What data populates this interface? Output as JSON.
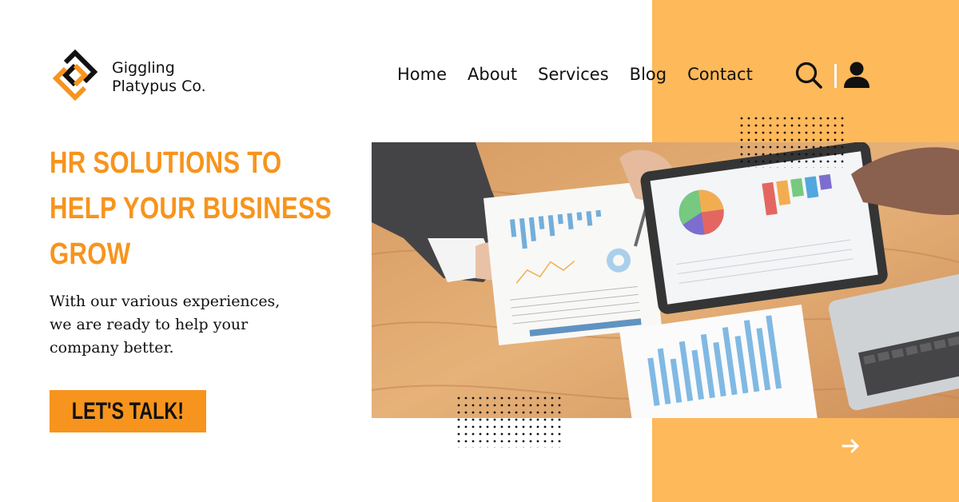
{
  "brand": {
    "name_line1": "Giggling",
    "name_line2": "Platypus Co.",
    "logo_icon": "diamond-arrows-logo"
  },
  "nav": {
    "items": [
      {
        "label": "Home"
      },
      {
        "label": "About"
      },
      {
        "label": "Services"
      },
      {
        "label": "Blog"
      },
      {
        "label": "Contact"
      }
    ],
    "icons": [
      "search-icon",
      "user-icon"
    ]
  },
  "hero": {
    "headline_lines": [
      "HR SOLUTIONS TO",
      "HELP YOUR BUSINESS",
      "GROW"
    ],
    "body_lines": [
      "With our various experiences,",
      "we are ready to help your",
      "company better."
    ],
    "cta_label": "LET'S TALK!",
    "image_icon": "business-charts-photo",
    "next_icon": "arrow-right-icon"
  },
  "colors": {
    "accent": "#f7941d",
    "panel": "#fdb95a",
    "text": "#111111",
    "background": "#ffffff"
  }
}
